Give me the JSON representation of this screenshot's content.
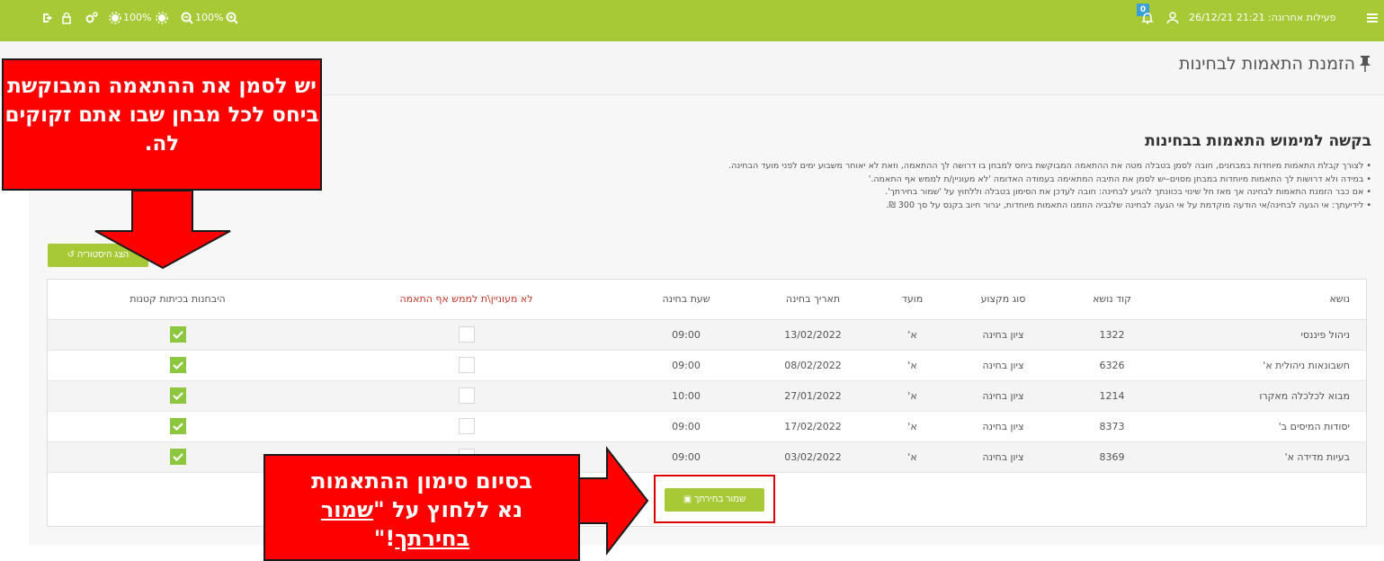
{
  "topbar": {
    "last_activity": "פעילות אחרונה: 21:21 26/12/21",
    "bell_badge": "0",
    "zoom_a": "100%",
    "zoom_b": "100%"
  },
  "page": {
    "title": "הזמנת התאמות לבחינות"
  },
  "section": {
    "title": "בקשה למימוש התאמות בבחינות",
    "notes": [
      "• לצורך קבלת התאמות מיוחדות במבחנים, חובה לסמן בטבלה מטה את ההתאמה המבוקשת ביחס למבחן בו דרושה לך ההתאמה, וזאת לא יאוחר משבוע ימים לפני מועד הבחינה.",
      "• במידה ולא דרושות לך התאמות מיוחדות במבחן מסוים–יש לסמן את התיבה המתאימה בעמודה האדומה 'לא מעוניין/ת לממש אף התאמה.'",
      "• אם כבר הזמנת התאמות לבחינה אך מאז חל שינוי בכוונתך להגיע לבחינה: חובה לעדכן את הסימון בטבלה וללחוץ על 'שמור בחירתך'.",
      "• לידיעתך: אי הגעה לבחינה/אי הודעה מוקדמת על אי הגעה לבחינה שלגביה הוזמנו התאמות מיוחדות, יגרור חיוב בקנס על סך 300 ₪."
    ]
  },
  "buttons": {
    "history": "הצג היסטוריה",
    "save": "שמור בחירתך"
  },
  "table": {
    "headers": {
      "subject": "נושא",
      "code": "קוד נושא",
      "type": "סוג מקצוע",
      "session": "מועד",
      "date": "תאריך בחינה",
      "time": "שעת בחינה",
      "none": "לא מעוניין\\ת לממש אף התאמה",
      "small_rooms": "היבחנות בכיתות קטנות"
    },
    "rows": [
      {
        "subject": "ניהול פיננסי",
        "code": "1322",
        "type": "ציון בחינה",
        "session": "א'",
        "date": "13/02/2022",
        "time": "09:00",
        "none": false,
        "small_rooms": true
      },
      {
        "subject": "חשבונאות ניהולית א'",
        "code": "6326",
        "type": "ציון בחינה",
        "session": "א'",
        "date": "08/02/2022",
        "time": "09:00",
        "none": false,
        "small_rooms": true
      },
      {
        "subject": "מבוא לכלכלה מאקרו",
        "code": "1214",
        "type": "ציון בחינה",
        "session": "א'",
        "date": "27/01/2022",
        "time": "10:00",
        "none": false,
        "small_rooms": true
      },
      {
        "subject": "יסודות המיסים ב'",
        "code": "8373",
        "type": "ציון בחינה",
        "session": "א'",
        "date": "17/02/2022",
        "time": "09:00",
        "none": false,
        "small_rooms": true
      },
      {
        "subject": "בעיות מדידה א'",
        "code": "8369",
        "type": "ציון בחינה",
        "session": "א'",
        "date": "03/02/2022",
        "time": "09:00",
        "none": false,
        "small_rooms": true
      }
    ]
  },
  "callouts": {
    "top_text": "יש לסמן את ההתאמה המבוקשת ביחס לכל מבחן שבו אתם זקוקים לה.",
    "bottom_line1": "בסיום סימון ההתאמות",
    "bottom_line2_prefix": "נא ללחוץ על \"",
    "bottom_link1": "שמור",
    "bottom_link2": "בחירתך",
    "bottom_suffix": "!\""
  },
  "colors": {
    "topbar": "#a6c935",
    "accent_green": "#8dc63f",
    "callout_red": "#ff0000",
    "warning_red": "#c0392b"
  }
}
